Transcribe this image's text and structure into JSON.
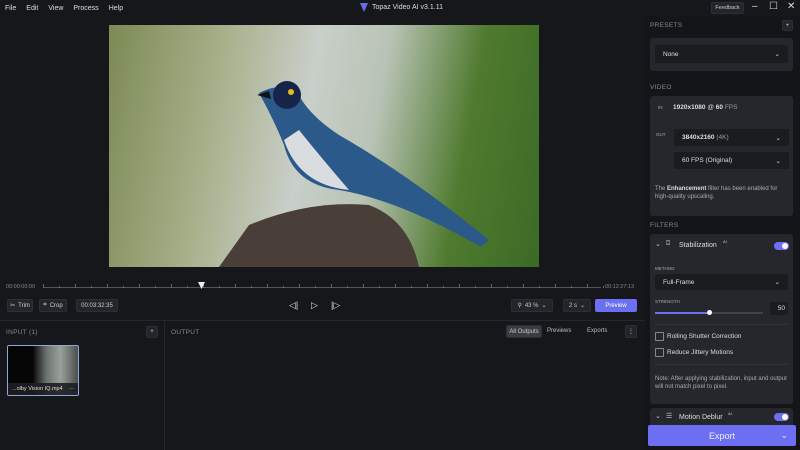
{
  "menu": [
    "File",
    "Edit",
    "View",
    "Process",
    "Help"
  ],
  "window": {
    "title": "Topaz Video AI  v3.1.11",
    "feedback": "Feedback"
  },
  "timeline": {
    "start": "00:00:00:00",
    "end": "00:12:27:13"
  },
  "controls": {
    "trim": "Trim",
    "crop": "Crop",
    "timecode": "00:03:32:35",
    "zoom": "43 %",
    "duration": "2 s",
    "preview": "Preview"
  },
  "input": {
    "header": "INPUT (1)",
    "file": "...olby Vision IQ.mp4"
  },
  "output": {
    "header": "OUTPUT",
    "tabs": [
      "All Outputs",
      "Previews",
      "Exports"
    ]
  },
  "presets": {
    "header": "PRESETS",
    "value": "None"
  },
  "video": {
    "header": "VIDEO",
    "in_label": "IN",
    "in_res": "1920x1080",
    "at": "@",
    "in_fps": "60",
    "fps_unit": "FPS",
    "out_label": "OUT",
    "out_res": "3840x2160",
    "out_res_tag": "(4K)",
    "out_fps": "60 FPS (Original)",
    "note_pre": "The",
    "note_bold": "Enhancement",
    "note_post": "filter has been enabled for high-quality upscaling."
  },
  "filters": {
    "header": "FILTERS",
    "stabilization": {
      "name": "Stabilization",
      "ai": "AI",
      "enabled": true,
      "method_label": "METHOD",
      "method": "Full-Frame",
      "strength_label": "STRENGTH",
      "strength": "50",
      "strength_fraction": 0.5,
      "rolling": "Rolling Shutter Correction",
      "jittery": "Reduce Jittery Motions",
      "note": "Note: After applying stabilization, input and output will not match pixel to pixel."
    },
    "motion_deblur": {
      "name": "Motion Deblur",
      "ai": "AI",
      "enabled": true
    }
  },
  "export": "Export"
}
